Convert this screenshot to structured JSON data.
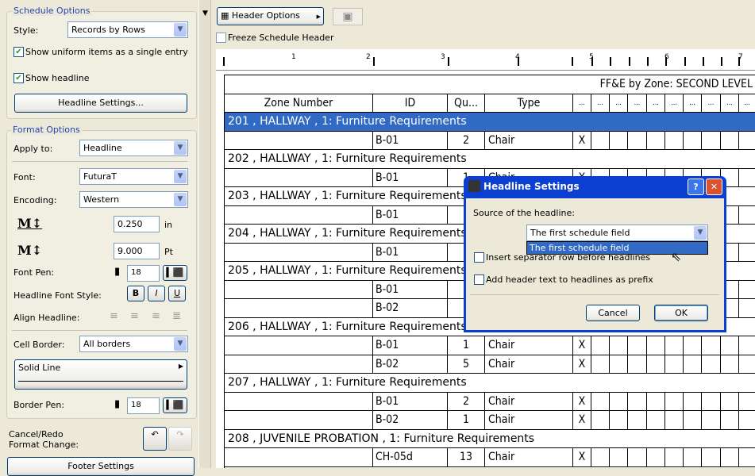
{
  "schedule_options": {
    "legend": "Schedule Options",
    "style_label": "Style:",
    "style_value": "Records by Rows",
    "uniform_label": "Show uniform items as a single entry",
    "uniform_checked": true,
    "headline_label": "Show headline",
    "headline_checked": true,
    "headline_settings_button": "Headline Settings..."
  },
  "format_options": {
    "legend": "Format Options",
    "apply_label": "Apply to:",
    "apply_value": "Headline",
    "font_label": "Font:",
    "font_value": "FuturaT",
    "encoding_label": "Encoding:",
    "encoding_value": "Western",
    "height_value": "0.250",
    "height_unit": "in",
    "size_value": "9.000",
    "size_unit": "Pt",
    "font_pen_label": "Font Pen:",
    "font_pen_value": "18",
    "style_label": "Headline Font Style:",
    "bold": "B",
    "italic": "I",
    "underline": "U",
    "align_label": "Align Headline:",
    "cell_border_label": "Cell Border:",
    "cell_border_value": "All borders",
    "line_type": "Solid Line",
    "border_pen_label": "Border Pen:",
    "border_pen_value": "18"
  },
  "cancel_redo_label": "Cancel/Redo\nFormat Change:",
  "footer_settings_button": "Footer Settings",
  "toolbar": {
    "header_options": "Header Options",
    "freeze_label": "Freeze Schedule Header"
  },
  "ruler": [
    "1",
    "2",
    "3",
    "4",
    "5",
    "6",
    "7"
  ],
  "schedule": {
    "title": "FF&E by Zone: SECOND LEVEL",
    "headers": [
      "Zone Number",
      "ID",
      "Qu...",
      "Type",
      "...",
      "...",
      "...",
      "...",
      "...",
      "...",
      "...",
      "...",
      "...",
      "..."
    ],
    "selection_color": "#316ac5",
    "rows": [
      {
        "group": "201 , HALLWAY , 1: Furniture Requirements",
        "selected": true
      },
      {
        "id": "B-01",
        "qty": "2",
        "type": "Chair",
        "x": "X"
      },
      {
        "group": "202 , HALLWAY , 1: Furniture Requirements"
      },
      {
        "id": "B-01",
        "qty": "1",
        "type": "Chair",
        "x": "X"
      },
      {
        "group": "203 , HALLWAY , 1: Furniture Requirements"
      },
      {
        "id": "B-01",
        "qty": "",
        "type": "",
        "x": ""
      },
      {
        "group": "204 , HALLWAY , 1: Furniture Requirements"
      },
      {
        "id": "B-01",
        "qty": "",
        "type": "",
        "x": ""
      },
      {
        "group": "205 , HALLWAY , 1: Furniture Requirements"
      },
      {
        "id": "B-01",
        "qty": "",
        "type": "",
        "x": ""
      },
      {
        "id": "B-02",
        "qty": "",
        "type": "",
        "x": ""
      },
      {
        "group": "206 , HALLWAY , 1: Furniture Requirements"
      },
      {
        "id": "B-01",
        "qty": "1",
        "type": "Chair",
        "x": "X"
      },
      {
        "id": "B-02",
        "qty": "5",
        "type": "Chair",
        "x": "X"
      },
      {
        "group": "207 , HALLWAY , 1: Furniture Requirements"
      },
      {
        "id": "B-01",
        "qty": "2",
        "type": "Chair",
        "x": "X"
      },
      {
        "id": "B-02",
        "qty": "1",
        "type": "Chair",
        "x": "X"
      },
      {
        "group": "208 , JUVENILE PROBATION , 1: Furniture Requirements"
      },
      {
        "id": "CH-05d",
        "qty": "13",
        "type": "Chair",
        "x": "X"
      }
    ]
  },
  "dialog": {
    "title": "Headline Settings",
    "source_label": "Source of the headline:",
    "source_value": "The first schedule field",
    "dropdown_option": "The first schedule field",
    "separator_label": "Insert separator row before headlines",
    "prefix_label": "Add header text to headlines as prefix",
    "cancel": "Cancel",
    "ok": "OK"
  }
}
